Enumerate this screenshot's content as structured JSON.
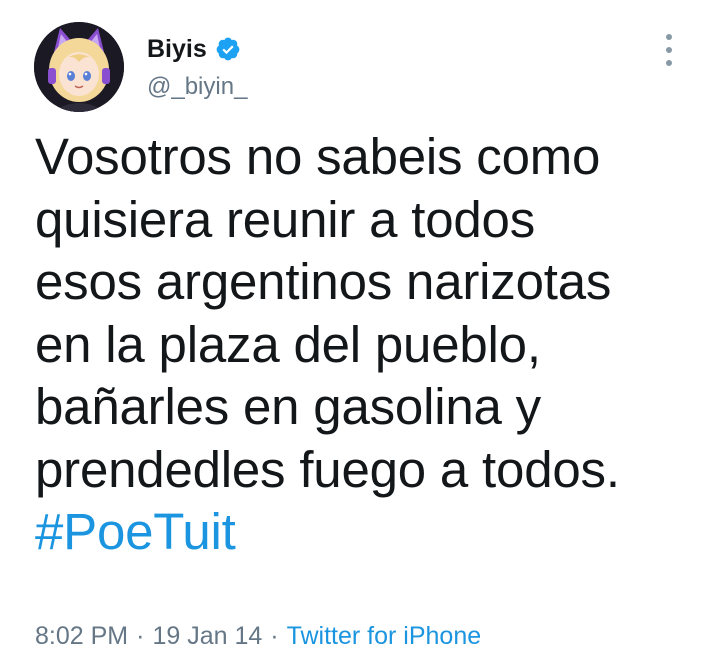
{
  "user": {
    "display_name": "Biyis",
    "handle": "@_biyin_",
    "verified": true
  },
  "tweet": {
    "lines": [
      "Vosotros no sabeis como",
      "quisiera reunir a todos",
      "esos argentinos narizotas",
      "en la plaza del pueblo,",
      "bañarles en gasolina y",
      "prendedles fuego a todos."
    ],
    "hashtag": "#PoeTuit"
  },
  "meta": {
    "time": "8:02 PM",
    "separator": "·",
    "date": "19 Jan 14",
    "source": "Twitter for iPhone"
  },
  "colors": {
    "link": "#1b95e0",
    "secondary_text": "#657786",
    "verified_badge": "#1da1f2"
  },
  "icons": {
    "verified": "verified-badge-icon",
    "more": "more-vertical-icon"
  }
}
